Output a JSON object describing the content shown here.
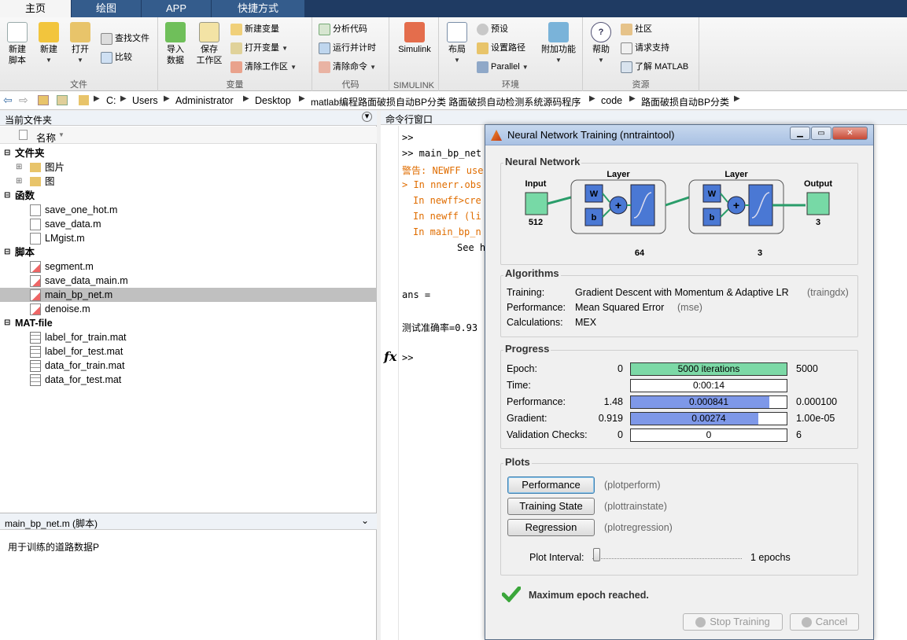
{
  "ribbon": {
    "tabs": [
      "主页",
      "绘图",
      "APP",
      "快捷方式"
    ],
    "groups": {
      "file": {
        "label": "文件",
        "new_script": "新建\n脚本",
        "new": "新建",
        "open": "打开",
        "find_files": "查找文件",
        "compare": "比较"
      },
      "variable": {
        "label": "变量",
        "import": "导入\n数据",
        "save_ws": "保存\n工作区",
        "new_var": "新建变量",
        "open_var": "打开变量",
        "clear_ws": "清除工作区"
      },
      "code": {
        "label": "代码",
        "analyze": "分析代码",
        "run_time": "运行并计时",
        "clear_cmd": "清除命令"
      },
      "simulink": {
        "label": "SIMULINK",
        "simulink": "Simulink"
      },
      "env": {
        "label": "环境",
        "layout": "布局",
        "prefs": "预设",
        "set_path": "设置路径",
        "parallel": "Parallel",
        "addons": "附加功能"
      },
      "resources": {
        "label": "资源",
        "help": "帮助",
        "community": "社区",
        "support": "请求支持",
        "learn": "了解 MATLAB"
      }
    }
  },
  "address": {
    "crumbs": [
      "C:",
      "Users",
      "Administrator",
      "Desktop",
      "matlab编程路面破损自动BP分类 路面破损自动检测系统源码程序",
      "code",
      "路面破损自动BP分类"
    ]
  },
  "current_folder": {
    "title": "当前文件夹",
    "column": "名称",
    "sections": [
      {
        "name": "文件夹",
        "items": [
          "图片",
          "图"
        ]
      },
      {
        "name": "函数",
        "items": [
          "save_one_hot.m",
          "save_data.m",
          "LMgist.m"
        ]
      },
      {
        "name": "脚本",
        "items": [
          "segment.m",
          "save_data_main.m",
          "main_bp_net.m",
          "denoise.m"
        ]
      },
      {
        "name": "MAT-file",
        "items": [
          "label_for_train.mat",
          "label_for_test.mat",
          "data_for_train.mat",
          "data_for_test.mat"
        ]
      }
    ],
    "selected": "main_bp_net.m",
    "detail_title": "main_bp_net.m  (脚本)",
    "detail_text": "用于训练的道路数据P"
  },
  "command_window": {
    "title": "命令行窗口",
    "lines": [
      ">>",
      ">> main_bp_net",
      "警告: NEWFF use",
      "> In nnerr.obs",
      "In newff>cre",
      "In newff (li",
      "In main_bp_n",
      "See h",
      "ans =",
      "测试准确率=0.93",
      ">>"
    ],
    "fx": "fx"
  },
  "nntool": {
    "title": "Neural Network Training (nntraintool)",
    "network": {
      "section": "Neural Network",
      "input_label": "Input",
      "input_size": "512",
      "layer_label": "Layer",
      "w": "W",
      "b": "b",
      "hidden_size": "64",
      "out_layer_size": "3",
      "output_label": "Output",
      "output_size": "3"
    },
    "algorithms": {
      "section": "Algorithms",
      "rows": [
        {
          "label": "Training:",
          "value": "Gradient Descent with Momentum & Adaptive LR",
          "fn": "(traingdx)"
        },
        {
          "label": "Performance:",
          "value": "Mean Squared Error",
          "fn": "(mse)"
        },
        {
          "label": "Calculations:",
          "value": "MEX",
          "fn": ""
        }
      ]
    },
    "progress": {
      "section": "Progress",
      "rows": [
        {
          "label": "Epoch:",
          "min": "0",
          "text": "5000 iterations",
          "max": "5000",
          "fill": 1.0,
          "color": "#7cd9a6"
        },
        {
          "label": "Time:",
          "min": "",
          "text": "0:00:14",
          "max": "",
          "fill": 0.0,
          "color": "#ffffff"
        },
        {
          "label": "Performance:",
          "min": "1.48",
          "text": "0.000841",
          "max": "0.000100",
          "fill": 0.89,
          "color": "#7e98e8"
        },
        {
          "label": "Gradient:",
          "min": "0.919",
          "text": "0.00274",
          "max": "1.00e-05",
          "fill": 0.82,
          "color": "#7e98e8"
        },
        {
          "label": "Validation Checks:",
          "min": "0",
          "text": "0",
          "max": "6",
          "fill": 0.0,
          "color": "#ffffff"
        }
      ]
    },
    "plots": {
      "section": "Plots",
      "buttons": [
        {
          "label": "Performance",
          "fn": "(plotperform)"
        },
        {
          "label": "Training State",
          "fn": "(plottrainstate)"
        },
        {
          "label": "Regression",
          "fn": "(plotregression)"
        }
      ],
      "interval_label": "Plot Interval:",
      "interval_value": "1 epochs",
      "interval_fraction": 0.0
    },
    "status": "Maximum epoch reached.",
    "stop_label": "Stop Training",
    "cancel_label": "Cancel"
  }
}
